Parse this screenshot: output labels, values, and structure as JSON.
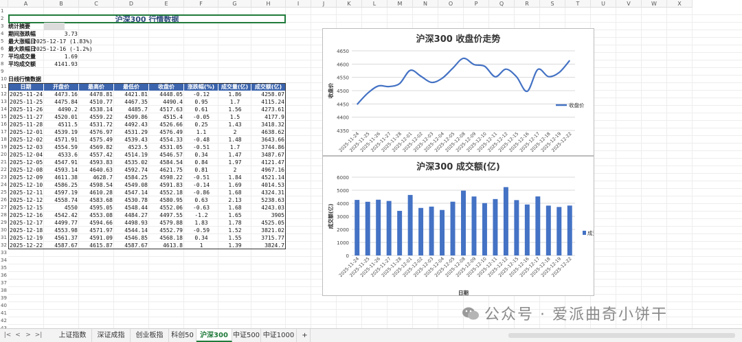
{
  "columns": [
    "A",
    "B",
    "C",
    "D",
    "E",
    "F",
    "G",
    "H",
    "I",
    "J",
    "K",
    "L",
    "M",
    "N",
    "O",
    "P",
    "Q",
    "R",
    "S",
    "T",
    "U",
    "V",
    "W",
    "X"
  ],
  "rows": [
    "1",
    "2",
    "3",
    "4",
    "5",
    "6",
    "7",
    "8",
    "9",
    "10",
    "11",
    "12",
    "13",
    "14",
    "15",
    "16",
    "17",
    "18",
    "19",
    "20",
    "21",
    "22",
    "23",
    "24",
    "25",
    "26",
    "27",
    "28",
    "29",
    "30",
    "31",
    "32",
    "33",
    "34",
    "35",
    "36",
    "37",
    "38",
    "39",
    "40",
    "41",
    "42",
    "43"
  ],
  "sheet_title": "沪深300 行情数据",
  "summary": {
    "heading": "统计摘要",
    "items": [
      {
        "label": "期间涨跌幅",
        "value": "3.73"
      },
      {
        "label": "最大涨幅日",
        "value": "2025-12-17 (1.83%)"
      },
      {
        "label": "最大跌幅日",
        "value": "2025-12-16 (-1.2%)"
      },
      {
        "label": "平均成交量",
        "value": "1.69"
      },
      {
        "label": "平均成交额",
        "value": "4141.93"
      }
    ]
  },
  "daily_heading": "日线行情数据",
  "table": {
    "headers": [
      "日期",
      "开盘价",
      "最高价",
      "最低价",
      "收盘价",
      "涨跌幅(%)",
      "成交量(亿)",
      "成交额(亿)"
    ],
    "rows": [
      [
        "2025-11-24",
        "4473.16",
        "4478.81",
        "4421.81",
        "4448.05",
        "-0.12",
        "1.86",
        "4258.07"
      ],
      [
        "2025-11-25",
        "4475.84",
        "4510.77",
        "4467.35",
        "4490.4",
        "0.95",
        "1.7",
        "4115.24"
      ],
      [
        "2025-11-26",
        "4490.2",
        "4538.14",
        "4485.7",
        "4517.63",
        "0.61",
        "1.56",
        "4273.61"
      ],
      [
        "2025-11-27",
        "4520.01",
        "4559.22",
        "4509.86",
        "4515.4",
        "-0.05",
        "1.5",
        "4177.9"
      ],
      [
        "2025-11-28",
        "4511.5",
        "4531.72",
        "4492.43",
        "4526.66",
        "0.25",
        "1.43",
        "3418.32"
      ],
      [
        "2025-12-01",
        "4539.19",
        "4576.97",
        "4531.29",
        "4576.49",
        "1.1",
        "2",
        "4638.62"
      ],
      [
        "2025-12-02",
        "4571.91",
        "4575.49",
        "4539.43",
        "4554.33",
        "-0.48",
        "1.48",
        "3643.66"
      ],
      [
        "2025-12-03",
        "4554.59",
        "4569.82",
        "4523.5",
        "4531.05",
        "-0.51",
        "1.7",
        "3744.86"
      ],
      [
        "2025-12-04",
        "4533.6",
        "4557.42",
        "4514.19",
        "4546.57",
        "0.34",
        "1.47",
        "3487.67"
      ],
      [
        "2025-12-05",
        "4547.91",
        "4593.83",
        "4535.02",
        "4584.54",
        "0.84",
        "1.97",
        "4121.47"
      ],
      [
        "2025-12-08",
        "4593.14",
        "4640.63",
        "4592.74",
        "4621.75",
        "0.81",
        "2",
        "4967.16"
      ],
      [
        "2025-12-09",
        "4611.38",
        "4628.7",
        "4584.25",
        "4598.22",
        "-0.51",
        "1.84",
        "4521.14"
      ],
      [
        "2025-12-10",
        "4586.25",
        "4598.54",
        "4549.08",
        "4591.83",
        "-0.14",
        "1.69",
        "4014.53"
      ],
      [
        "2025-12-11",
        "4597.19",
        "4610.28",
        "4547.14",
        "4552.18",
        "-0.86",
        "1.68",
        "4324.31"
      ],
      [
        "2025-12-12",
        "4558.74",
        "4583.68",
        "4530.78",
        "4580.95",
        "0.63",
        "2.13",
        "5238.63"
      ],
      [
        "2025-12-15",
        "4550",
        "4595.05",
        "4548.44",
        "4552.06",
        "-0.63",
        "1.68",
        "4243.03"
      ],
      [
        "2025-12-16",
        "4542.42",
        "4553.08",
        "4484.27",
        "4497.55",
        "-1.2",
        "1.65",
        "3905"
      ],
      [
        "2025-12-17",
        "4499.77",
        "4594.66",
        "4498.93",
        "4579.88",
        "1.83",
        "1.78",
        "4525.05"
      ],
      [
        "2025-12-18",
        "4553.98",
        "4571.97",
        "4544.14",
        "4552.79",
        "-0.59",
        "1.52",
        "3821.02"
      ],
      [
        "2025-12-19",
        "4561.37",
        "4591.09",
        "4546.85",
        "4568.18",
        "0.34",
        "1.55",
        "3715.77"
      ],
      [
        "2025-12-22",
        "4587.67",
        "4615.87",
        "4587.67",
        "4613.8",
        "1",
        "1.39",
        "3824.7"
      ]
    ]
  },
  "chart_data": [
    {
      "type": "line",
      "title": "沪深300 收盘价走势",
      "ylabel": "收盘价",
      "xlabel": "",
      "ylim": [
        4350,
        4650
      ],
      "yticks": [
        "4350",
        "4400",
        "4450",
        "4500",
        "4550",
        "4600",
        "4650"
      ],
      "grid": true,
      "legend": "right",
      "categories": [
        "2025-11-24",
        "2025-11-25",
        "2025-11-26",
        "2025-11-27",
        "2025-11-28",
        "2025-12-01",
        "2025-12-02",
        "2025-12-03",
        "2025-12-04",
        "2025-12-05",
        "2025-12-08",
        "2025-12-09",
        "2025-12-10",
        "2025-12-11",
        "2025-12-12",
        "2025-12-15",
        "2025-12-16",
        "2025-12-17",
        "2025-12-18",
        "2025-12-19",
        "2025-12-22"
      ],
      "series": [
        {
          "name": "收盘价",
          "color": "#4472c4",
          "values": [
            4448.05,
            4490.4,
            4517.63,
            4515.4,
            4526.66,
            4576.49,
            4554.33,
            4531.05,
            4546.57,
            4584.54,
            4621.75,
            4598.22,
            4591.83,
            4552.18,
            4580.95,
            4552.06,
            4497.55,
            4579.88,
            4552.79,
            4568.18,
            4613.8
          ]
        }
      ]
    },
    {
      "type": "bar",
      "title": "沪深300 成交额(亿)",
      "ylabel": "成交额(亿)",
      "xlabel": "日期",
      "ylim": [
        0,
        6000
      ],
      "yticks": [
        "0",
        "1000",
        "2000",
        "3000",
        "4000",
        "5000",
        "6000"
      ],
      "grid": true,
      "legend": "right",
      "categories": [
        "2025-11-24",
        "2025-11-25",
        "2025-11-26",
        "2025-11-27",
        "2025-11-28",
        "2025-12-01",
        "2025-12-02",
        "2025-12-03",
        "2025-12-04",
        "2025-12-05",
        "2025-12-08",
        "2025-12-09",
        "2025-12-10",
        "2025-12-11",
        "2025-12-12",
        "2025-12-15",
        "2025-12-16",
        "2025-12-17",
        "2025-12-18",
        "2025-12-19",
        "2025-12-22"
      ],
      "series": [
        {
          "name": "成交额(亿)",
          "color": "#4472c4",
          "values": [
            4258.07,
            4115.24,
            4273.61,
            4177.9,
            3418.32,
            4638.62,
            3643.66,
            3744.86,
            3487.67,
            4121.47,
            4967.16,
            4521.14,
            4014.53,
            4324.31,
            5238.63,
            4243.03,
            3905,
            4525.05,
            3821.02,
            3715.77,
            3824.7
          ]
        }
      ]
    }
  ],
  "tabs": [
    "上证指数",
    "深证成指",
    "创业板指",
    "科创50",
    "沪深300",
    "中证500",
    "中证1000"
  ],
  "active_tab": "沪深300",
  "add_tab_label": "+",
  "nav_arrows": [
    "|<",
    "<",
    ">",
    ">|"
  ],
  "watermark": "公众号 · 爱派曲奇小饼干"
}
